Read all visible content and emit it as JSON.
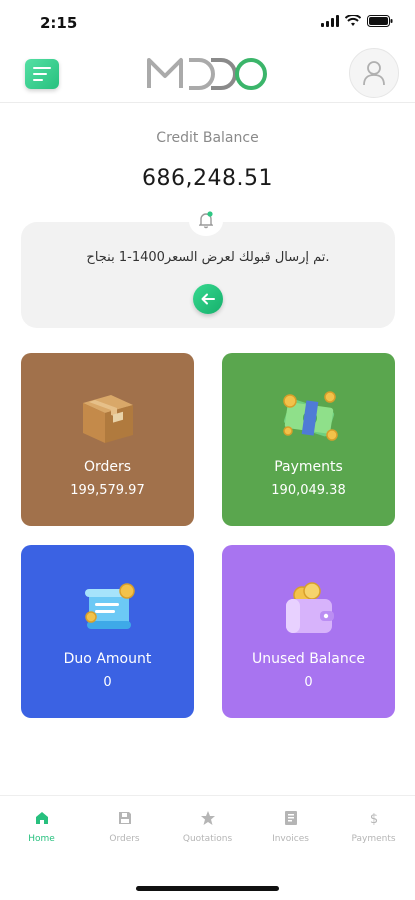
{
  "status_bar": {
    "time": "2:15"
  },
  "header": {
    "logo_text": "MDDO"
  },
  "balance": {
    "label": "Credit Balance",
    "value": "686,248.51"
  },
  "notice": {
    "message": ".تم إرسال قبولك لعرض السعر1400-1 بنجاح"
  },
  "cards": [
    {
      "title": "Orders",
      "value": "199,579.97",
      "color": "#a1714b",
      "icon": "box-icon"
    },
    {
      "title": "Payments",
      "value": "190,049.38",
      "color": "#5aa64e",
      "icon": "money-icon"
    },
    {
      "title": "Duo Amount",
      "value": "0",
      "color": "#3b62e3",
      "icon": "receipt-icon"
    },
    {
      "title": "Unused Balance",
      "value": "0",
      "color": "#a874f0",
      "icon": "wallet-icon"
    }
  ],
  "bottom_nav": [
    {
      "label": "Home",
      "icon": "home-icon",
      "active": true
    },
    {
      "label": "Orders",
      "icon": "save-icon",
      "active": false
    },
    {
      "label": "Quotations",
      "icon": "star-icon",
      "active": false
    },
    {
      "label": "Invoices",
      "icon": "invoice-icon",
      "active": false
    },
    {
      "label": "Payments",
      "icon": "dollar-icon",
      "active": false
    }
  ],
  "colors": {
    "accent": "#27c07e"
  }
}
